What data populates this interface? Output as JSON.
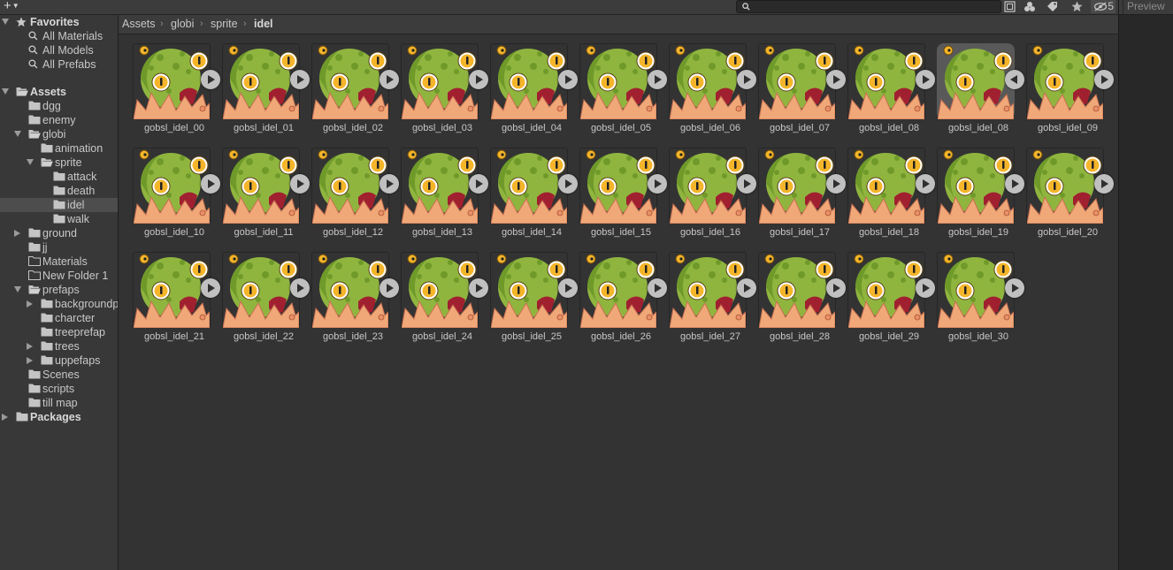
{
  "toolbar": {
    "add_icon": "plus-icon",
    "search_value": "",
    "hidden_count": "5"
  },
  "preview": {
    "tab_label": "Preview"
  },
  "tree": {
    "favorites_label": "Favorites",
    "favorites": [
      "All Materials",
      "All Models",
      "All Prefabs"
    ],
    "assets_label": "Assets",
    "assets": [
      {
        "label": "dgg",
        "level": 1,
        "arrow": "none"
      },
      {
        "label": "enemy",
        "level": 1,
        "arrow": "none"
      },
      {
        "label": "globi",
        "level": 1,
        "arrow": "down"
      },
      {
        "label": "animation",
        "level": 2,
        "arrow": "none"
      },
      {
        "label": "sprite",
        "level": 2,
        "arrow": "down"
      },
      {
        "label": "attack",
        "level": 3,
        "arrow": "none"
      },
      {
        "label": "death",
        "level": 3,
        "arrow": "none"
      },
      {
        "label": "idel",
        "level": 3,
        "arrow": "none",
        "selected": true
      },
      {
        "label": "walk",
        "level": 3,
        "arrow": "none"
      },
      {
        "label": "ground",
        "level": 1,
        "arrow": "right"
      },
      {
        "label": "jj",
        "level": 1,
        "arrow": "none"
      },
      {
        "label": "Materials",
        "level": 1,
        "arrow": "none",
        "empty": true
      },
      {
        "label": "New Folder 1",
        "level": 1,
        "arrow": "none",
        "empty": true
      },
      {
        "label": "prefaps",
        "level": 1,
        "arrow": "down"
      },
      {
        "label": "backgroundprefab",
        "level": 2,
        "arrow": "right"
      },
      {
        "label": "charcter",
        "level": 2,
        "arrow": "none"
      },
      {
        "label": "treeprefap",
        "level": 2,
        "arrow": "none"
      },
      {
        "label": "trees",
        "level": 2,
        "arrow": "right"
      },
      {
        "label": "uppefaps",
        "level": 2,
        "arrow": "right"
      },
      {
        "label": "Scenes",
        "level": 1,
        "arrow": "none"
      },
      {
        "label": "scripts",
        "level": 1,
        "arrow": "none"
      },
      {
        "label": "till map",
        "level": 1,
        "arrow": "none"
      }
    ],
    "packages_label": "Packages"
  },
  "breadcrumb": [
    "Assets",
    "globi",
    "sprite",
    "idel"
  ],
  "sprites": [
    "gobsl_idel_00",
    "gobsl_idel_01",
    "gobsl_idel_02",
    "gobsl_idel_03",
    "gobsl_idel_04",
    "gobsl_idel_05",
    "gobsl_idel_06",
    "gobsl_idel_07",
    "gobsl_idel_08",
    "gobsl_idel_08",
    "gobsl_idel_09",
    "gobsl_idel_10",
    "gobsl_idel_11",
    "gobsl_idel_12",
    "gobsl_idel_13",
    "gobsl_idel_14",
    "gobsl_idel_15",
    "gobsl_idel_16",
    "gobsl_idel_17",
    "gobsl_idel_18",
    "gobsl_idel_19",
    "gobsl_idel_20",
    "gobsl_idel_21",
    "gobsl_idel_22",
    "gobsl_idel_23",
    "gobsl_idel_24",
    "gobsl_idel_25",
    "gobsl_idel_26",
    "gobsl_idel_27",
    "gobsl_idel_28",
    "gobsl_idel_29",
    "gobsl_idel_30"
  ],
  "selected_sprite_index": 9,
  "colors": {
    "monster_green": "#8fb53f",
    "monster_spots": "#6f9a2a",
    "eye_yellow": "#f5b52a",
    "mouth_orange": "#f0a878"
  }
}
